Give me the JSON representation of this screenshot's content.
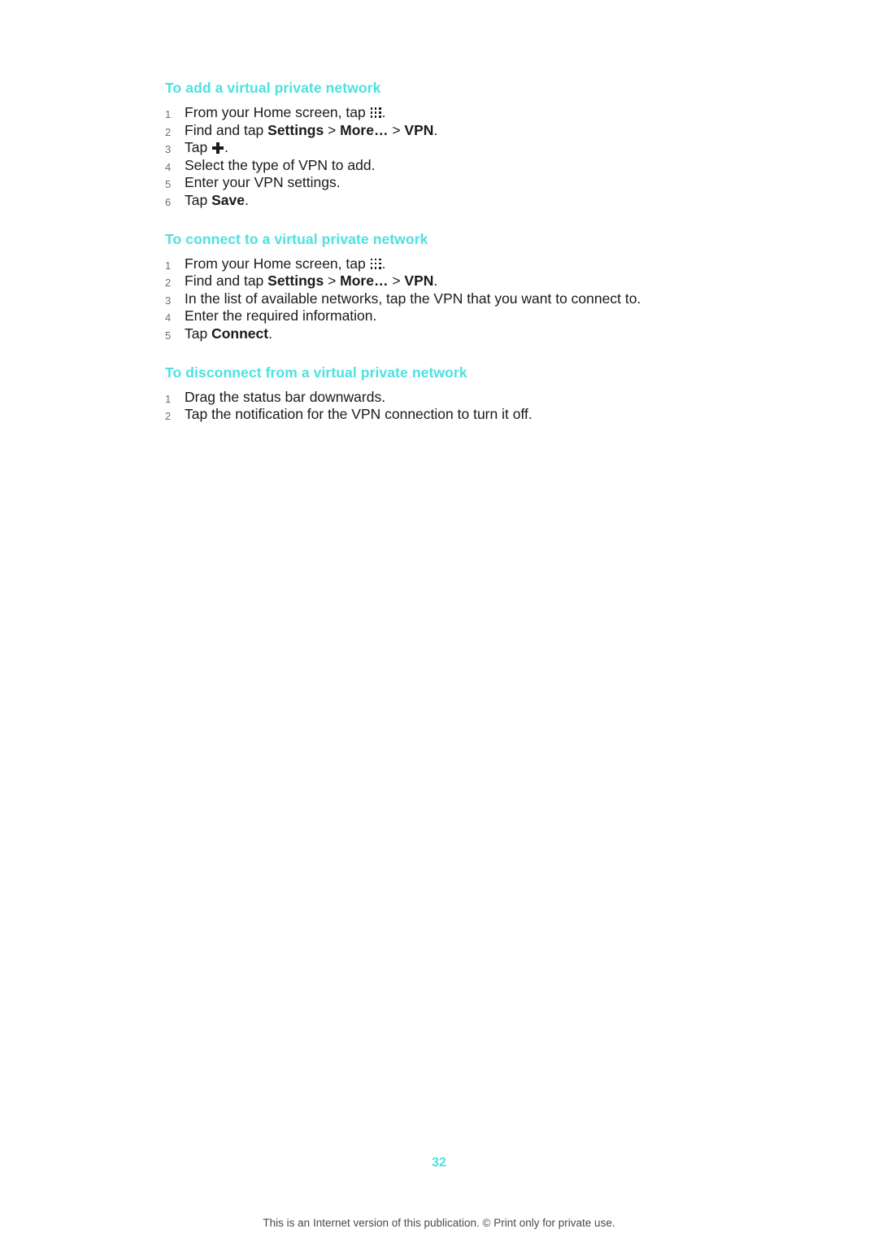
{
  "page": {
    "number": "32",
    "footer": "This is an Internet version of this publication. © Print only for private use.",
    "heading_color": "#4de1e1"
  },
  "sections": [
    {
      "heading": "To add a virtual private network",
      "steps": [
        {
          "num": "1",
          "parts": [
            {
              "t": "From your Home screen, tap "
            },
            {
              "icon": "app-grid-icon"
            },
            {
              "t": "."
            }
          ]
        },
        {
          "num": "2",
          "parts": [
            {
              "t": "Find and tap "
            },
            {
              "t": "Settings",
              "b": true
            },
            {
              "t": " > "
            },
            {
              "t": "More…",
              "b": true
            },
            {
              "t": " > "
            },
            {
              "t": "VPN",
              "b": true
            },
            {
              "t": "."
            }
          ]
        },
        {
          "num": "3",
          "parts": [
            {
              "t": "Tap "
            },
            {
              "icon": "plus-icon"
            },
            {
              "t": "."
            }
          ]
        },
        {
          "num": "4",
          "parts": [
            {
              "t": "Select the type of VPN to add."
            }
          ]
        },
        {
          "num": "5",
          "parts": [
            {
              "t": "Enter your VPN settings."
            }
          ]
        },
        {
          "num": "6",
          "parts": [
            {
              "t": "Tap "
            },
            {
              "t": "Save",
              "b": true
            },
            {
              "t": "."
            }
          ]
        }
      ]
    },
    {
      "heading": "To connect to a virtual private network",
      "steps": [
        {
          "num": "1",
          "parts": [
            {
              "t": "From your Home screen, tap "
            },
            {
              "icon": "app-grid-icon"
            },
            {
              "t": "."
            }
          ]
        },
        {
          "num": "2",
          "parts": [
            {
              "t": "Find and tap "
            },
            {
              "t": "Settings",
              "b": true
            },
            {
              "t": " > "
            },
            {
              "t": "More…",
              "b": true
            },
            {
              "t": " > "
            },
            {
              "t": "VPN",
              "b": true
            },
            {
              "t": "."
            }
          ]
        },
        {
          "num": "3",
          "parts": [
            {
              "t": "In the list of available networks, tap the VPN that you want to connect to."
            }
          ]
        },
        {
          "num": "4",
          "parts": [
            {
              "t": "Enter the required information."
            }
          ]
        },
        {
          "num": "5",
          "parts": [
            {
              "t": "Tap "
            },
            {
              "t": "Connect",
              "b": true
            },
            {
              "t": "."
            }
          ]
        }
      ]
    },
    {
      "heading": "To disconnect from a virtual private network",
      "steps": [
        {
          "num": "1",
          "parts": [
            {
              "t": "Drag the status bar downwards."
            }
          ]
        },
        {
          "num": "2",
          "parts": [
            {
              "t": "Tap the notification for the VPN connection to turn it off."
            }
          ]
        }
      ]
    }
  ]
}
